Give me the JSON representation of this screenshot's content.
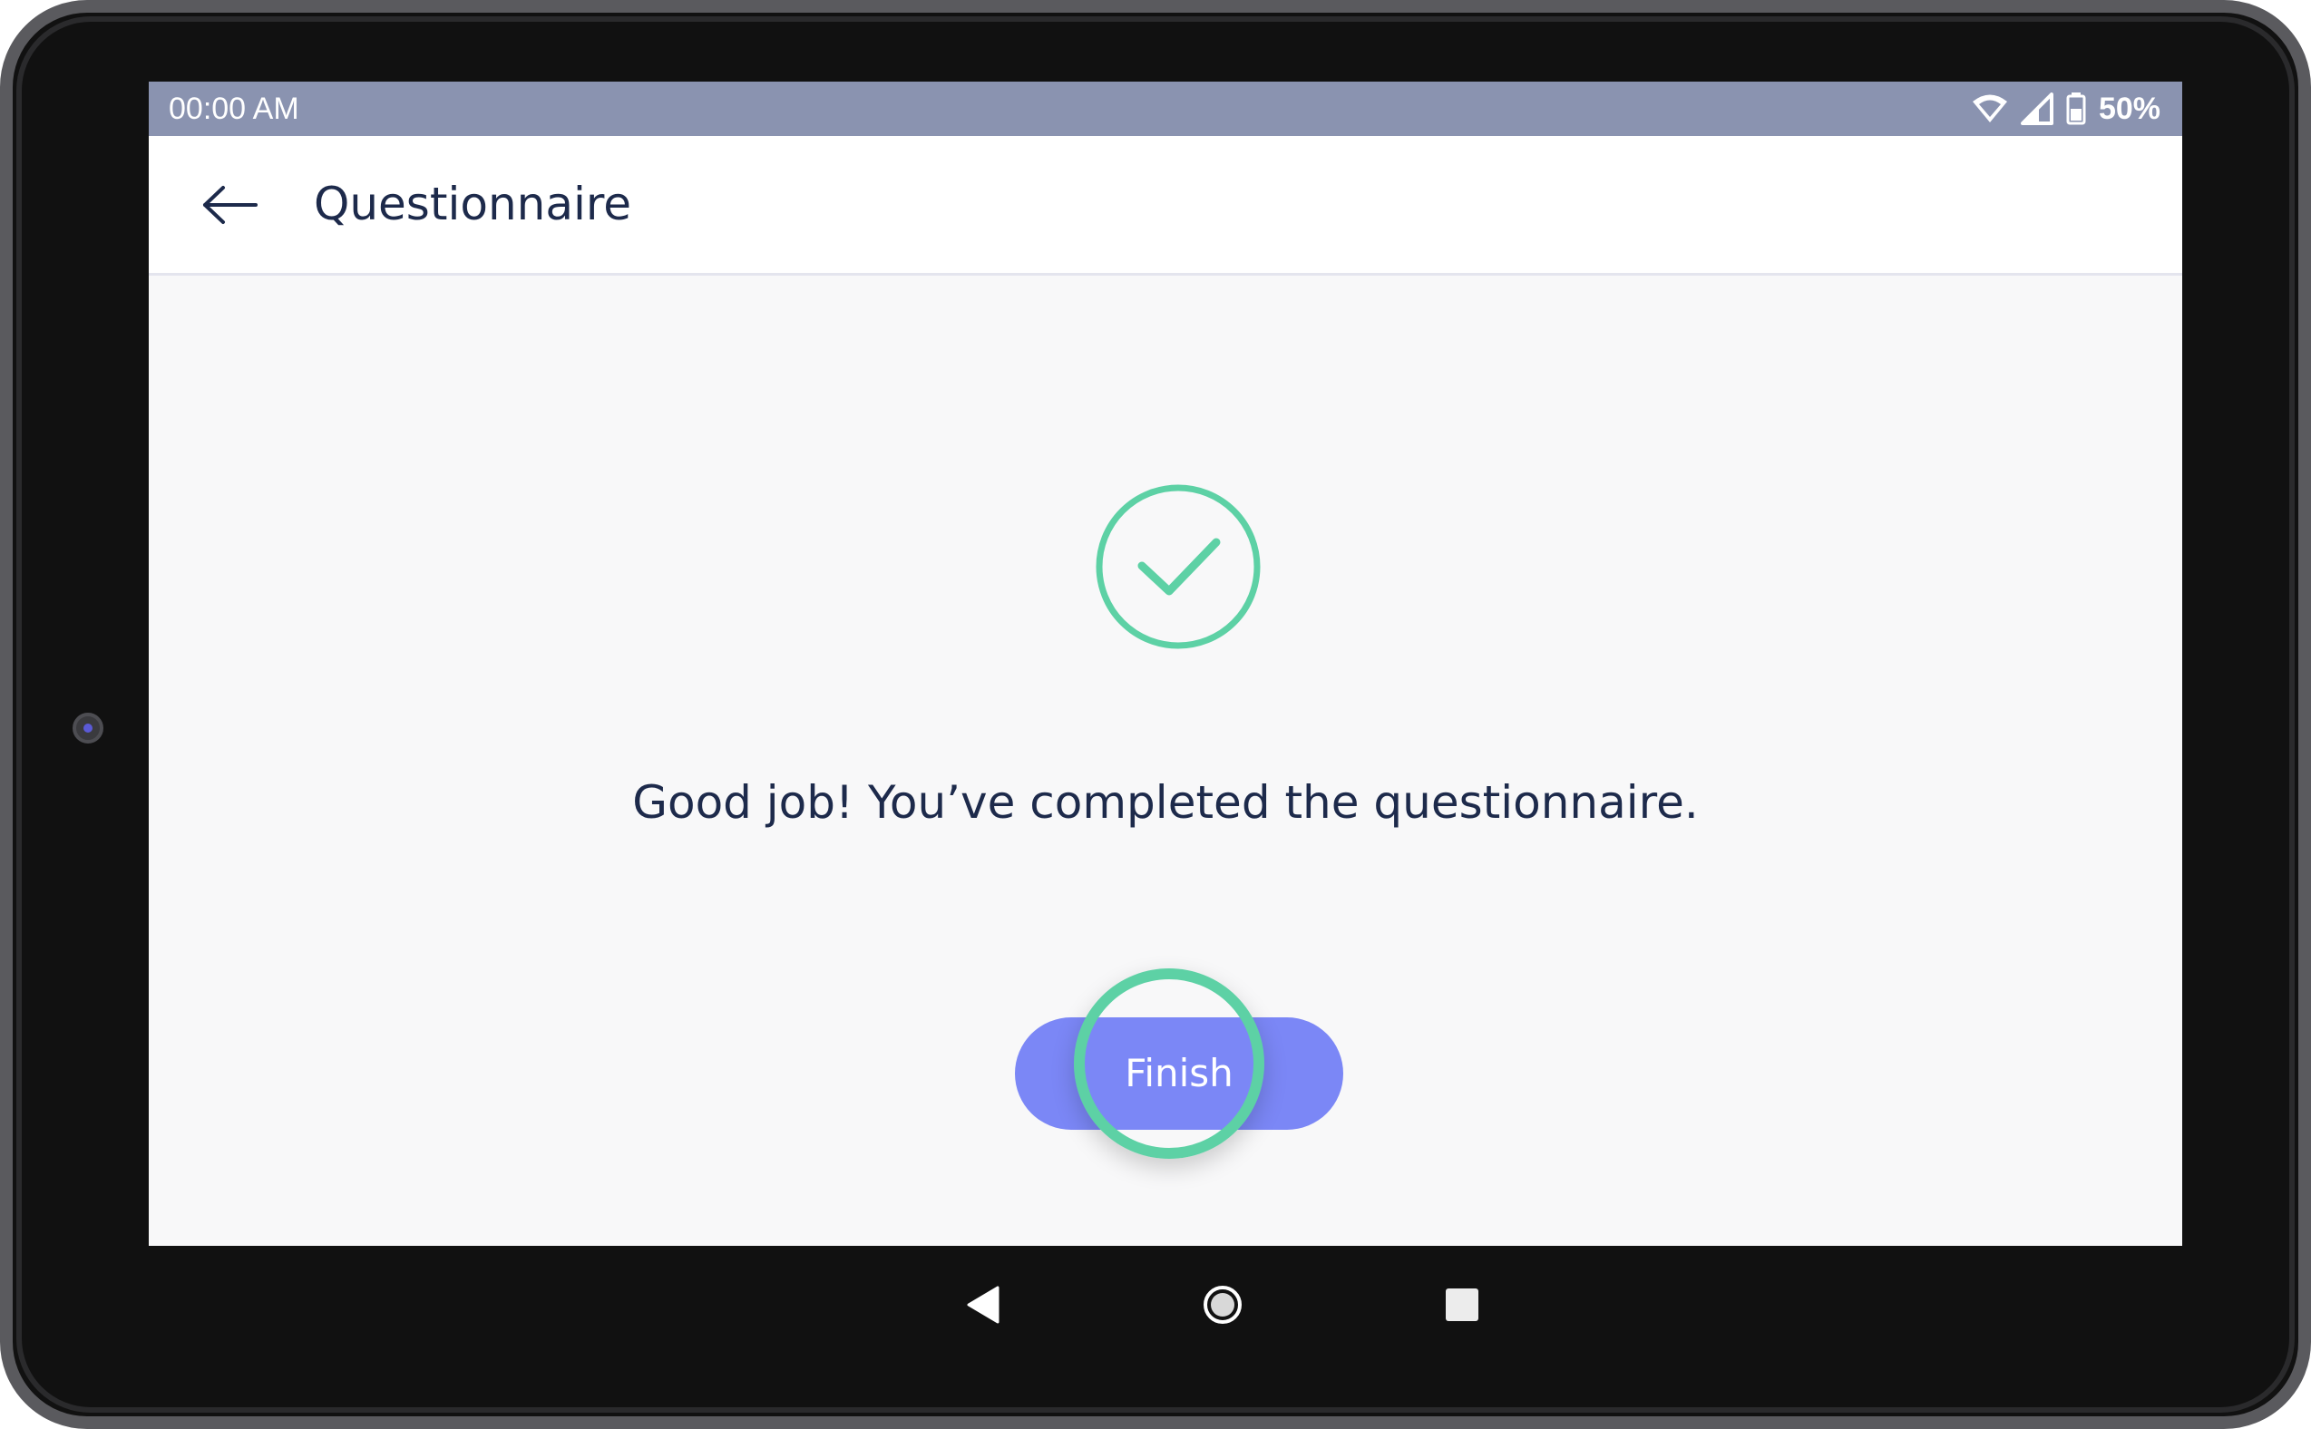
{
  "status_bar": {
    "time": "00:00 AM",
    "battery_percent": "50%",
    "icons": [
      "wifi-icon",
      "cell-signal-icon",
      "battery-icon"
    ]
  },
  "app_bar": {
    "back_icon": "arrow-left-icon",
    "title": "Questionnaire"
  },
  "completion": {
    "icon": "check-circle-icon",
    "message": "Good job! You’ve completed the questionnaire.",
    "finish_label": "Finish"
  },
  "nav_bar": {
    "icons": [
      "back-triangle-icon",
      "home-circle-icon",
      "recents-square-icon"
    ]
  },
  "colors": {
    "status_bar": "#8a93b0",
    "accent_green": "#5dd1a5",
    "button_blue": "#7b87f6",
    "text_dark": "#1d2a4b",
    "background": "#f8f8f9"
  }
}
